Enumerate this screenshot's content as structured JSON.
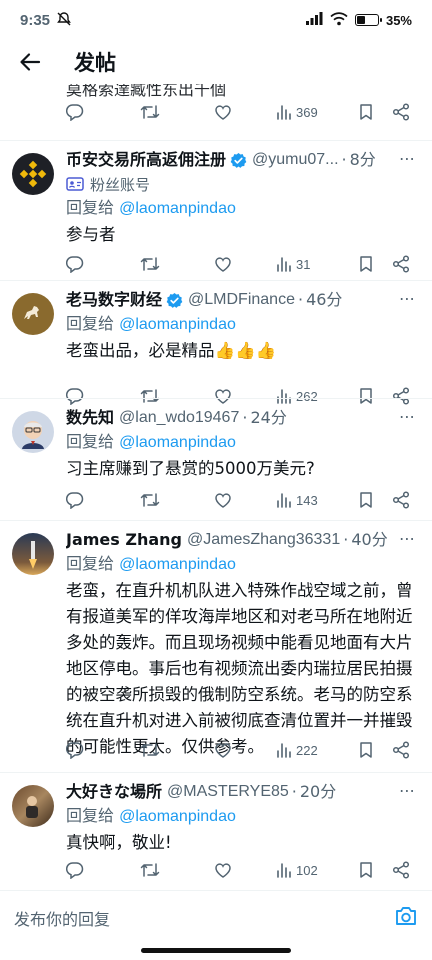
{
  "status_bar": {
    "time": "9:35",
    "battery": "35%"
  },
  "header": {
    "title": "发帖"
  },
  "partial_tweet": {
    "text": "莫格索達臧性东出千個",
    "views": "369"
  },
  "replies": [
    {
      "name": "币安交易所高返佣注册",
      "verified": true,
      "handle": "@yumu07...",
      "time": "8分",
      "fan_label": "粉丝账号",
      "reply_prefix": "回复给",
      "reply_to": "@laomanpindao",
      "text": "参与者",
      "views": "31"
    },
    {
      "name": "老马数字财经",
      "verified": true,
      "handle": "@LMDFinance",
      "time": "46分",
      "reply_prefix": "回复给",
      "reply_to": "@laomanpindao",
      "text": "老蛮出品，必是精品👍👍👍",
      "views": "262"
    },
    {
      "name": "数先知",
      "verified": false,
      "handle": "@lan_wdo19467",
      "time": "24分",
      "reply_prefix": "回复给",
      "reply_to": "@laomanpindao",
      "text": "习主席赚到了悬赏的5000万美元?",
      "views": "143"
    },
    {
      "name": "James Zhang",
      "verified": false,
      "handle": "@JamesZhang36331",
      "time": "40分",
      "reply_prefix": "回复给",
      "reply_to": "@laomanpindao",
      "text": "老蛮，在直升机机队进入特殊作战空域之前，曾有报道美军的佯攻海岸地区和对老马所在地附近多处的轰炸。而且现场视频中能看见地面有大片地区停电。事后也有视频流出委内瑞拉居民拍摄的被空袭所损毁的俄制防空系统。老马的防空系统在直升机对进入前被彻底查清位置并一并摧毁的可能性更大。仅供参考。",
      "views": "222"
    },
    {
      "name": "大好きな場所",
      "verified": false,
      "handle": "@MASTERYE85",
      "time": "20分",
      "reply_prefix": "回复给",
      "reply_to": "@laomanpindao",
      "text": "真快啊，敬业!",
      "views": "102"
    }
  ],
  "composer": {
    "placeholder": "发布你的回复"
  },
  "colors": {
    "accent": "#1d9bf0",
    "secondary_text": "#536471",
    "verified": "#1d9bf0"
  }
}
